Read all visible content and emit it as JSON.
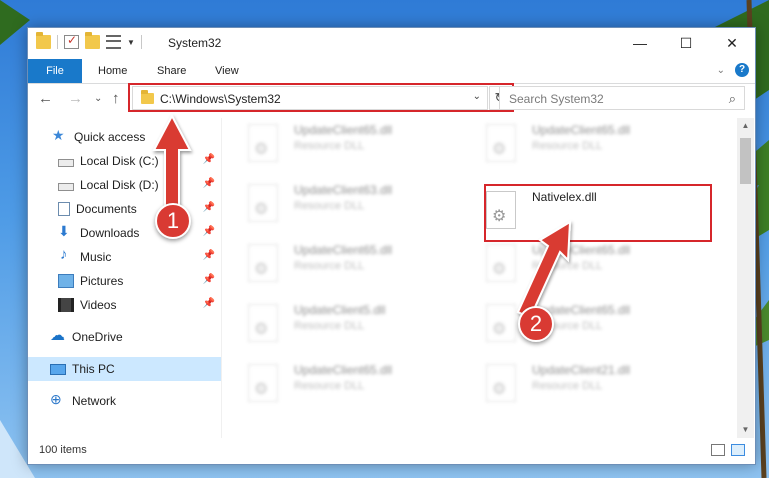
{
  "window": {
    "title": "System32",
    "minimize": "—",
    "maximize": "☐",
    "close": "✕"
  },
  "ribbon": {
    "tabs": [
      "File",
      "Home",
      "Share",
      "View"
    ],
    "help": "?",
    "expand": "⌄"
  },
  "nav": {
    "back": "←",
    "forward": "→",
    "recent": "⌄",
    "up": "↑",
    "address": "C:\\Windows\\System32",
    "address_dropdown": "⌄",
    "refresh": "↻",
    "search_placeholder": "Search System32",
    "search_icon": "⌕"
  },
  "sidebar": {
    "items": [
      {
        "label": "Quick access",
        "icon": "star-icon",
        "pinned": false
      },
      {
        "label": "Local Disk (C:)",
        "icon": "disk-icon",
        "pinned": true
      },
      {
        "label": "Local Disk (D:)",
        "icon": "disk-icon",
        "pinned": true
      },
      {
        "label": "Documents",
        "icon": "documents-icon",
        "pinned": true
      },
      {
        "label": "Downloads",
        "icon": "downloads-icon",
        "pinned": true
      },
      {
        "label": "Music",
        "icon": "music-icon",
        "pinned": true
      },
      {
        "label": "Pictures",
        "icon": "pictures-icon",
        "pinned": true
      },
      {
        "label": "Videos",
        "icon": "videos-icon",
        "pinned": true
      },
      {
        "label": "OneDrive",
        "icon": "onedrive-icon",
        "pinned": false
      },
      {
        "label": "This PC",
        "icon": "this-pc-icon",
        "pinned": false,
        "selected": true
      },
      {
        "label": "Network",
        "icon": "network-icon",
        "pinned": false
      }
    ],
    "pin_glyph": "📌"
  },
  "files": {
    "left_column": [
      {
        "name": "UpdateClient65.dll",
        "type": "Resource DLL"
      },
      {
        "name": "UpdateClient63.dll",
        "type": "Resource DLL"
      },
      {
        "name": "UpdateClient65.dll",
        "type": "Resource DLL"
      },
      {
        "name": "UpdateClient5.dll",
        "type": "Resource DLL"
      },
      {
        "name": "UpdateClient65.dll",
        "type": "Resource DLL"
      }
    ],
    "right_column": [
      {
        "name": "UpdateClient65.dll",
        "type": "Resource DLL"
      },
      {
        "name": "Nativelex.dll",
        "type": ""
      },
      {
        "name": "UpdateClient65.dll",
        "type": "Resource DLL"
      },
      {
        "name": "UpdateClient65.dll",
        "type": "Resource DLL"
      },
      {
        "name": "UpdateClient21.dll",
        "type": "Resource DLL"
      }
    ]
  },
  "status": {
    "item_count": "100 items"
  },
  "annotations": {
    "step1": "1",
    "step2": "2"
  },
  "colors": {
    "accent": "#1979ca",
    "highlight": "#d6262b",
    "selected": "#cce8ff"
  }
}
